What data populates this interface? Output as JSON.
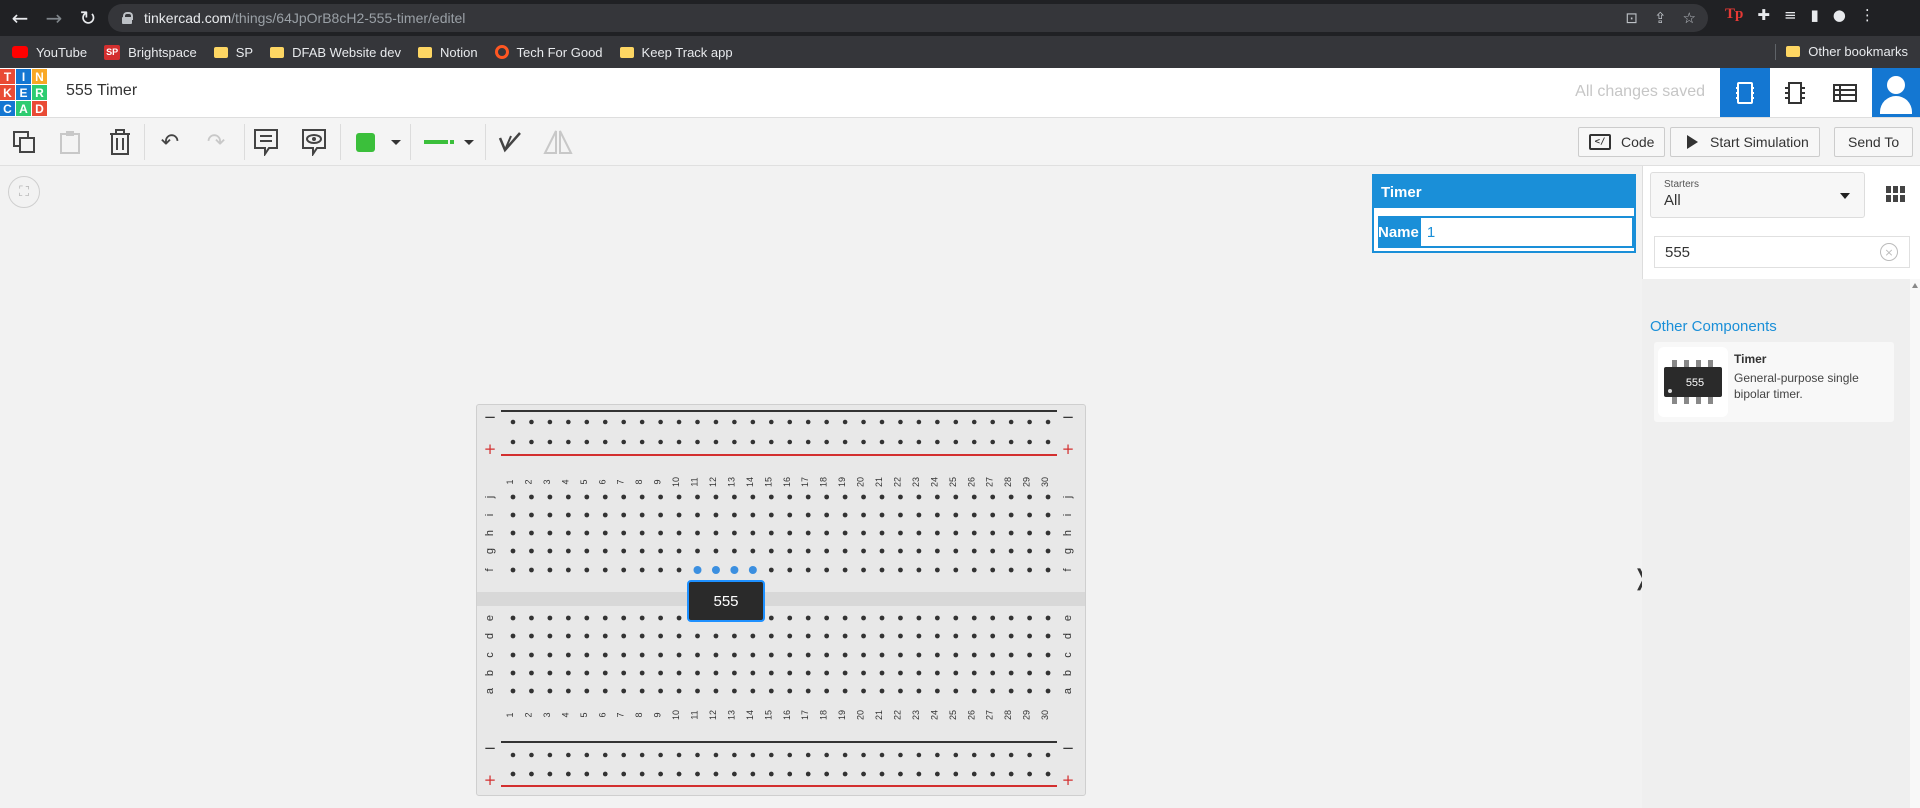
{
  "browser": {
    "url_host": "tinkercad.com",
    "url_path": "/things/64JpOrB8cH2-555-timer/editel",
    "bookmarks": [
      {
        "label": "YouTube",
        "icon": "youtube-icon"
      },
      {
        "label": "Brightspace",
        "icon": "sp-icon"
      },
      {
        "label": "SP",
        "icon": "folder-icon"
      },
      {
        "label": "DFAB Website dev",
        "icon": "folder-icon"
      },
      {
        "label": "Notion",
        "icon": "folder-icon"
      },
      {
        "label": "Tech For Good",
        "icon": "tfg-icon"
      },
      {
        "label": "Keep Track app",
        "icon": "folder-icon"
      }
    ],
    "other_bookmarks": "Other bookmarks"
  },
  "header": {
    "logo_letters": [
      "T",
      "I",
      "N",
      "K",
      "E",
      "R",
      "C",
      "A",
      "D"
    ],
    "logo_colors": [
      "#e94b35",
      "#1477d2",
      "#f9a825",
      "#e94b35",
      "#1477d2",
      "#2ecc71",
      "#1477d2",
      "#2ecc71",
      "#e94b35"
    ],
    "title": "555 Timer",
    "save_status": "All changes saved"
  },
  "toolbar": {
    "code_label": "Code",
    "code_icon_text": "</",
    "simulate_label": "Start Simulation",
    "send_label": "Send To",
    "wire_color": "#3bbf3b"
  },
  "inspector": {
    "title": "Timer",
    "name_label": "Name",
    "name_value": "1"
  },
  "breadboard": {
    "rail_top_minus": "−",
    "rail_top_plus": "+",
    "rail_bottom_minus": "−",
    "rail_bottom_plus": "+",
    "columns": [
      "1",
      "2",
      "3",
      "4",
      "5",
      "6",
      "7",
      "8",
      "9",
      "10",
      "11",
      "12",
      "13",
      "14",
      "15",
      "16",
      "17",
      "18",
      "19",
      "20",
      "21",
      "22",
      "23",
      "24",
      "25",
      "26",
      "27",
      "28",
      "29",
      "30"
    ],
    "rows_top": [
      "j",
      "i",
      "h",
      "g",
      "f"
    ],
    "rows_bottom": [
      "e",
      "d",
      "c",
      "b",
      "a"
    ]
  },
  "chip": {
    "label": "555"
  },
  "components_panel": {
    "starters_label": "Starters",
    "starters_value": "All",
    "search_value": "555",
    "section_title": "Other Components",
    "items": [
      {
        "name": "Timer",
        "description": "General-purpose single bipolar timer.",
        "chip_label": "555"
      }
    ]
  }
}
